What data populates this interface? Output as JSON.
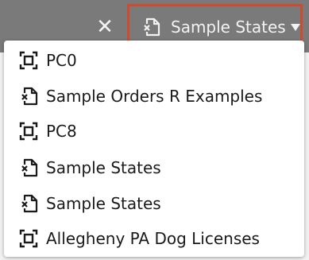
{
  "toolbar": {
    "close_glyph": "✕",
    "close_icon": "close-icon",
    "selected_datasource": {
      "label": "Sample States",
      "icon": "excel-file-icon"
    },
    "highlight_color": "#d04a2f"
  },
  "menu": {
    "items": [
      {
        "label": "PC0",
        "icon": "table-bracket-icon"
      },
      {
        "label": "Sample Orders R Examples",
        "icon": "excel-file-icon"
      },
      {
        "label": "PC8",
        "icon": "table-bracket-icon"
      },
      {
        "label": "Sample States",
        "icon": "excel-file-icon"
      },
      {
        "label": "Sample States",
        "icon": "excel-file-icon"
      },
      {
        "label": "Allegheny PA Dog Licenses",
        "icon": "table-bracket-icon"
      }
    ]
  }
}
